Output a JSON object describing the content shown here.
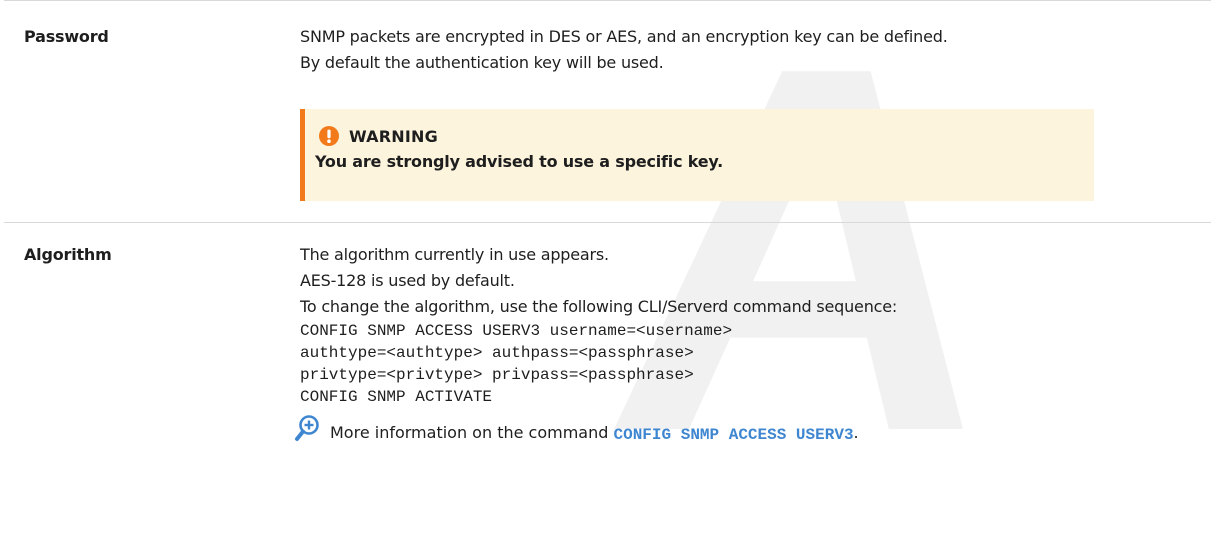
{
  "watermark": "A",
  "rows": [
    {
      "term": "Password",
      "lines": [
        "SNMP packets are encrypted in DES or AES, and an encryption key can be defined.",
        "By default the authentication key will be used."
      ],
      "warning": {
        "icon": "exclamation-circle-icon",
        "title": "WARNING",
        "text": "You are strongly advised to use a specific key.",
        "accent_color": "#f27a1a",
        "background_color": "#fdf4dd"
      }
    },
    {
      "term": "Algorithm",
      "lines": [
        "The algorithm currently in use appears.",
        "AES-128 is used by default.",
        "To change the algorithm, use the following CLI/Serverd command sequence:"
      ],
      "code": [
        "CONFIG SNMP ACCESS USERV3 username=<username>",
        "authtype=<authtype> authpass=<passphrase>",
        "privtype=<privtype> privpass=<passphrase>",
        "CONFIG SNMP ACTIVATE"
      ],
      "more": {
        "icon": "zoom-in-icon",
        "text": "More information on the command",
        "link": "CONFIG SNMP ACCESS USERV3",
        "suffix": ".",
        "link_color": "#3f86d1"
      }
    }
  ]
}
